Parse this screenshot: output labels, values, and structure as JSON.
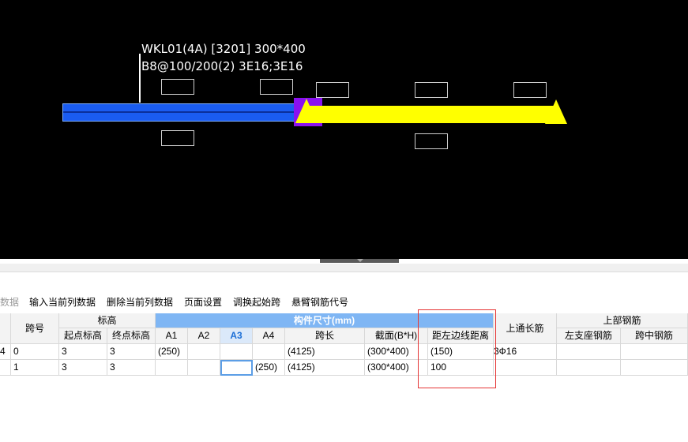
{
  "beam": {
    "label_line1": "WKL01(4A) [3201] 300*400",
    "label_line2": "B8@100/200(2) 3E16;3E16",
    "colors": {
      "span_blue": "#1a5cf0",
      "span_yellow": "#ffff00",
      "selection": "#8a11f0"
    }
  },
  "toolbar": {
    "items": [
      {
        "label": "数据",
        "enabled": false
      },
      {
        "label": "输入当前列数据",
        "enabled": true
      },
      {
        "label": "删除当前列数据",
        "enabled": true
      },
      {
        "label": "页面设置",
        "enabled": true
      },
      {
        "label": "调换起始跨",
        "enabled": true
      },
      {
        "label": "悬臂钢筋代号",
        "enabled": true
      }
    ]
  },
  "table": {
    "header": {
      "span_no": "跨号",
      "elevation": "标高",
      "start_elev": "起点标高",
      "end_elev": "终点标高",
      "dims_group": "构件尺寸(mm)",
      "a1": "A1",
      "a2": "A2",
      "a3": "A3",
      "a4": "A4",
      "span_len": "跨长",
      "section": "截面(B*H)",
      "left_dist": "距左边线距离",
      "top_through": "上通长筋",
      "top_rebar": "上部钢筋",
      "left_support": "左支座钢筋",
      "mid_span": "跨中钢筋"
    },
    "rows": [
      {
        "lead": "4",
        "span_no": "0",
        "start": "3",
        "end": "3",
        "a1": "(250)",
        "a2": "",
        "a3": "",
        "a4": "",
        "span_len": "(4125)",
        "section": "(300*400)",
        "left_dist": "(150)",
        "top_through": "3Ф16",
        "left_support": "",
        "mid_span": ""
      },
      {
        "lead": "",
        "span_no": "1",
        "start": "3",
        "end": "3",
        "a1": "",
        "a2": "",
        "a3": "",
        "a4": "(250)",
        "span_len": "(4125)",
        "section": "(300*400)",
        "left_dist": "100",
        "top_through": "",
        "left_support": "",
        "mid_span": ""
      }
    ]
  }
}
